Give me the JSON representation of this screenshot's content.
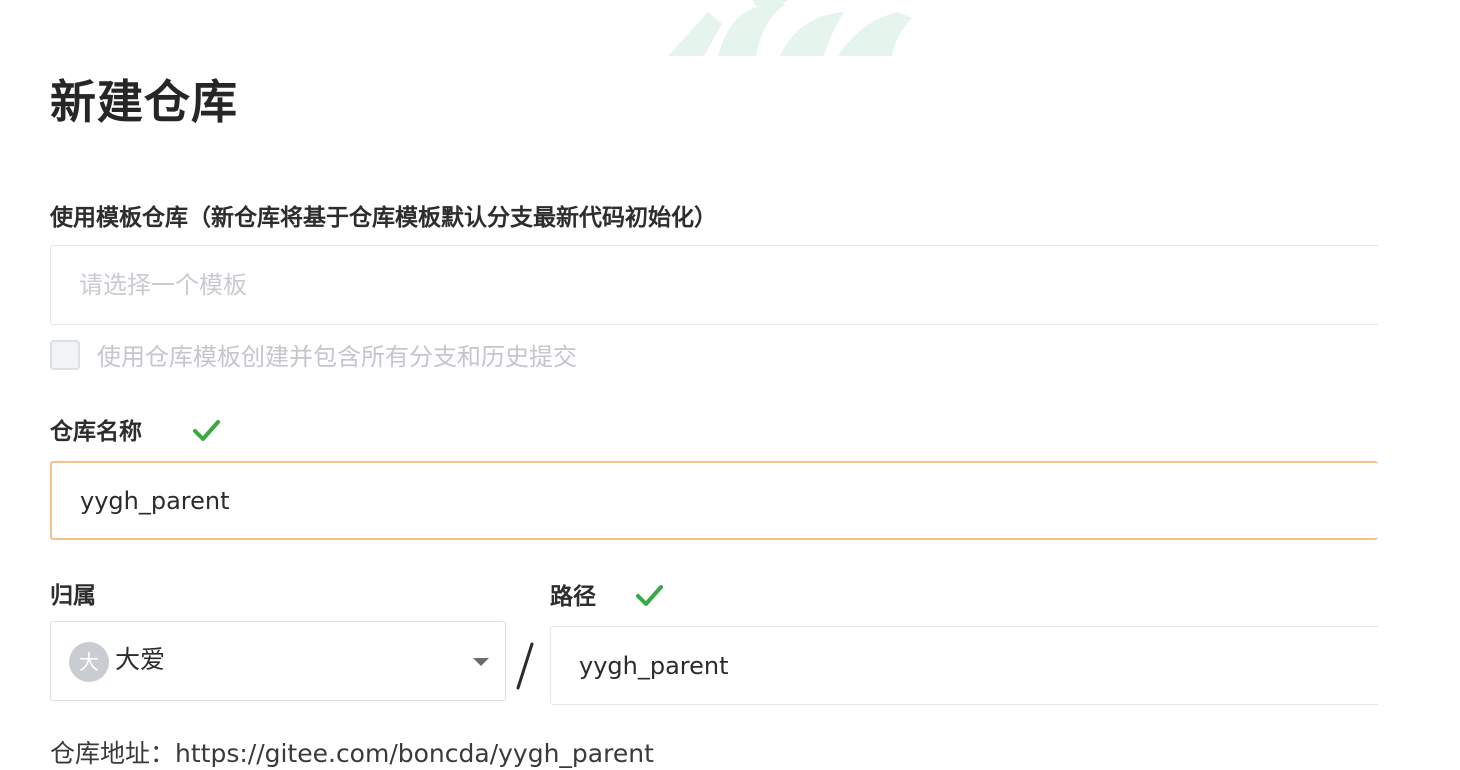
{
  "heading": "新建仓库",
  "template": {
    "label": "使用模板仓库（新仓库将基于仓库模板默认分支最新代码初始化）",
    "placeholder": "请选择一个模板",
    "include_branches_label": "使用仓库模板创建并包含所有分支和历史提交",
    "include_branches_checked": false
  },
  "repo_name": {
    "label": "仓库名称",
    "value": "yygh_parent",
    "valid": true
  },
  "owner": {
    "label": "归属",
    "avatar_text": "大",
    "value": "大爱"
  },
  "separator": "/",
  "path": {
    "label": "路径",
    "value": "yygh_parent",
    "valid": true
  },
  "address": {
    "text": "仓库地址：https://gitee.com/boncda/yygh_parent"
  },
  "colors": {
    "valid_check": "#3aa845",
    "focus_border": "#f6c08a",
    "deco": "#e8f5f0"
  },
  "icons": {
    "valid": "check-icon",
    "dropdown": "caret-down-icon"
  }
}
